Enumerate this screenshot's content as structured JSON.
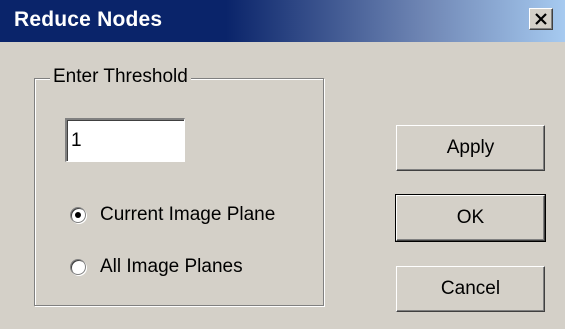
{
  "window": {
    "title": "Reduce Nodes"
  },
  "group": {
    "legend": "Enter Threshold",
    "threshold_value": "1",
    "radios": [
      {
        "label": "Current Image Plane",
        "selected": true
      },
      {
        "label": "All Image Planes",
        "selected": false
      }
    ]
  },
  "buttons": {
    "apply": "Apply",
    "ok": "OK",
    "cancel": "Cancel"
  },
  "icons": {
    "close": "close-icon",
    "radio": "radio-icon"
  }
}
